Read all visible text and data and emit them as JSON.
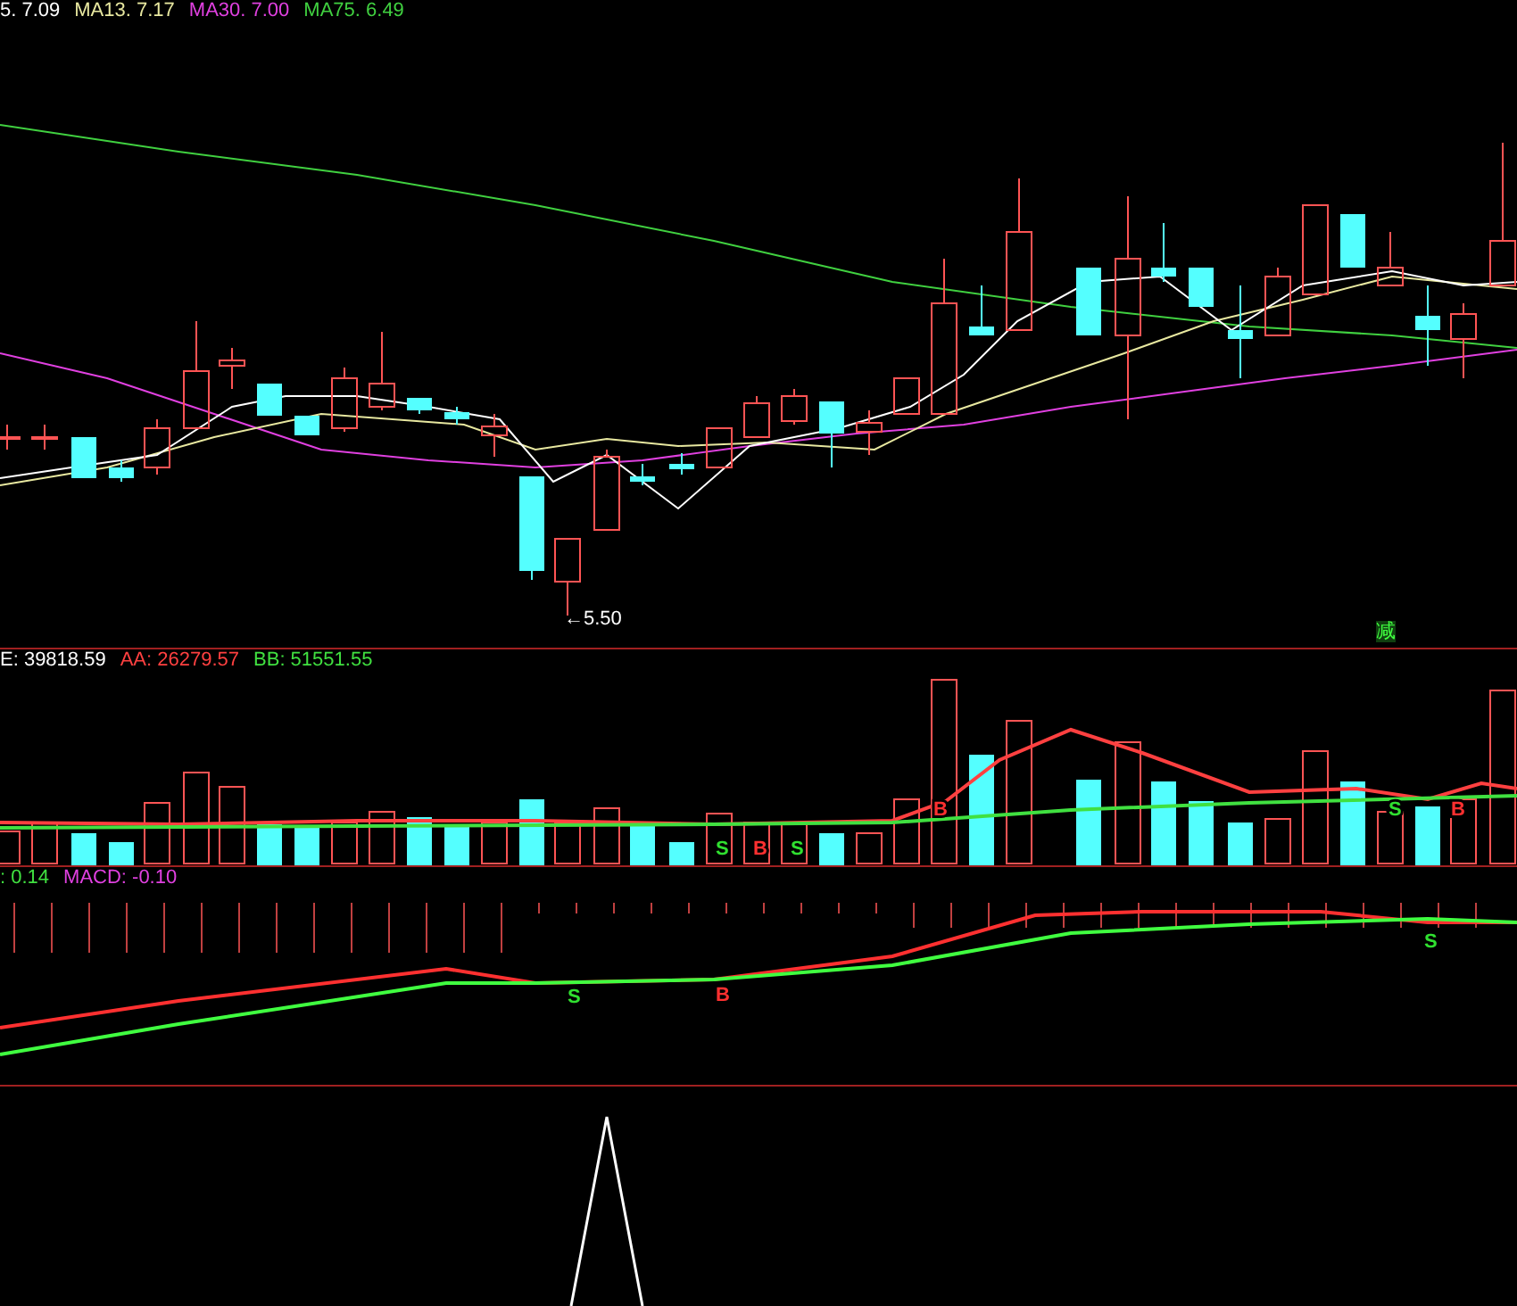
{
  "price_panel": {
    "legend": [
      {
        "text": "5. 7.09",
        "color": "#ffffff"
      },
      {
        "text": "MA13. 7.17",
        "color": "#e8e8a0"
      },
      {
        "text": "MA30. 7.00",
        "color": "#e040e0"
      },
      {
        "text": "MA75. 6.49",
        "color": "#40d040"
      }
    ],
    "low_label": "←5.50",
    "marker": "减"
  },
  "volume_panel": {
    "legend": [
      {
        "text": "E: 39818.59",
        "color": "#ffffff"
      },
      {
        "text": "AA: 26279.57",
        "color": "#ff4040"
      },
      {
        "text": "BB: 51551.55",
        "color": "#40e040"
      }
    ],
    "signals": [
      {
        "text": "S",
        "kind": "sell"
      },
      {
        "text": "B",
        "kind": "buy"
      },
      {
        "text": "S",
        "kind": "sell"
      },
      {
        "text": "B",
        "kind": "buy"
      },
      {
        "text": "S",
        "kind": "sell"
      },
      {
        "text": "B",
        "kind": "buy"
      }
    ]
  },
  "macd_panel": {
    "legend": [
      {
        "text": ": 0.14",
        "color": "#40e040"
      },
      {
        "text": "MACD: -0.10",
        "color": "#e040e0"
      }
    ],
    "signals": [
      {
        "text": "S",
        "kind": "sell"
      },
      {
        "text": "B",
        "kind": "buy"
      },
      {
        "text": "S",
        "kind": "sell"
      }
    ]
  }
}
